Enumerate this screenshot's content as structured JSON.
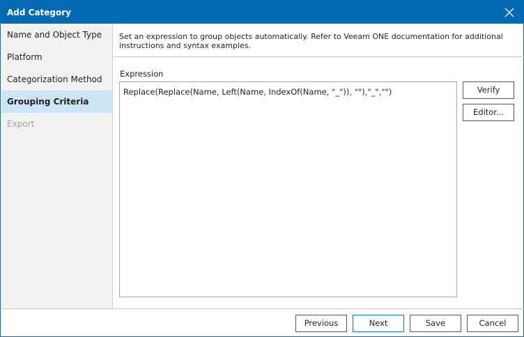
{
  "window": {
    "title": "Add Category"
  },
  "sidebar": {
    "items": [
      {
        "label": "Name and Object Type"
      },
      {
        "label": "Platform"
      },
      {
        "label": "Categorization Method"
      },
      {
        "label": "Grouping Criteria"
      },
      {
        "label": "Export"
      }
    ]
  },
  "main": {
    "description": "Set an expression to group objects automatically. Refer to Veeam ONE documentation for additional instructions and syntax examples.",
    "expression_label": "Expression",
    "expression_value": "Replace(Replace(Name, Left(Name, IndexOf(Name, \"_\")), \"\"),\"_\",\"\")",
    "verify_label": "Verify",
    "editor_label": "Editor..."
  },
  "footer": {
    "previous": "Previous",
    "next": "Next",
    "save": "Save",
    "cancel": "Cancel"
  }
}
